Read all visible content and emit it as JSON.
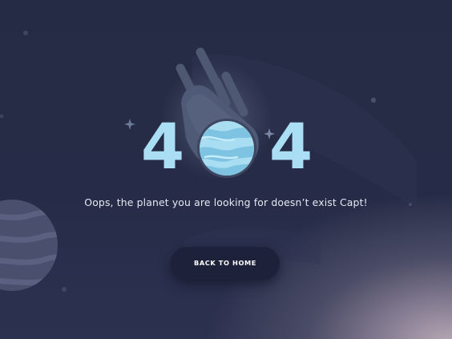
{
  "error_code": {
    "first_digit": "4",
    "last_digit": "4"
  },
  "message": "Oops, the planet you are looking for doesn’t exist Capt!",
  "back_button": {
    "label": "BACK TO HOME"
  },
  "colors": {
    "background": "#262b45",
    "digit": "#a9def4",
    "planet": "#a8ddf2",
    "button": "#1d2139",
    "text": "#e6e8f2"
  },
  "icons": [
    "comet-planet-icon",
    "sparkle-icon",
    "sparkle-icon",
    "large-planet-icon"
  ]
}
